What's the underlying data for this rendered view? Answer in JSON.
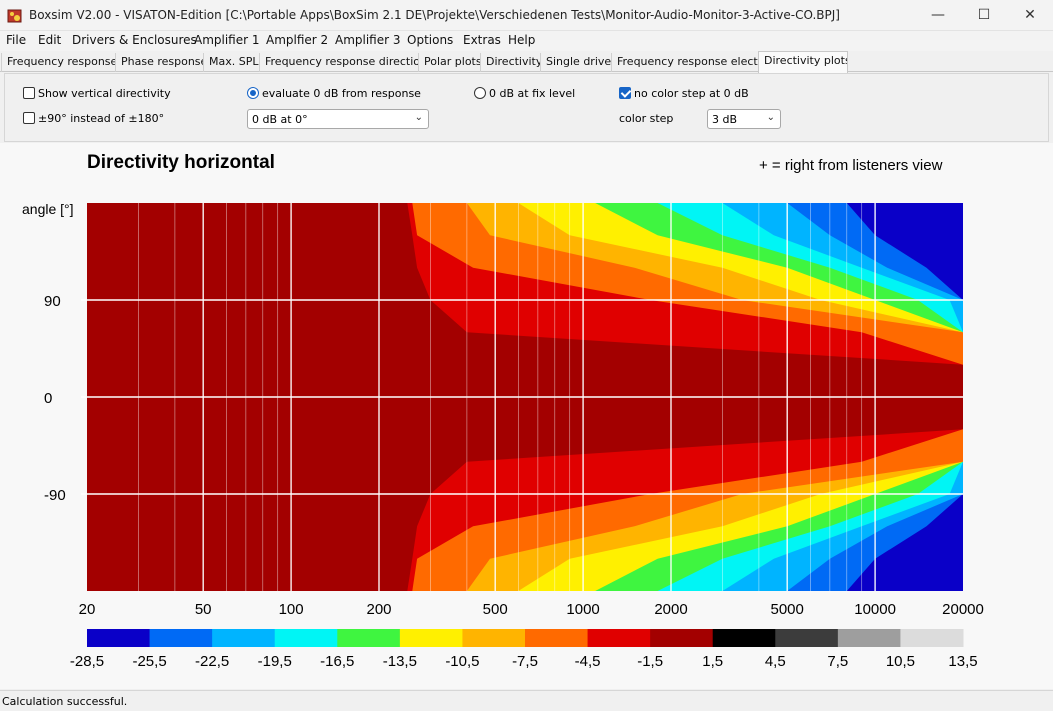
{
  "window": {
    "title": "Boxsim V2.00 - VISATON-Edition [C:\\Portable Apps\\BoxSim 2.1 DE\\Projekte\\Verschiedenen Tests\\Monitor-Audio-Monitor-3-Active-CO.BPJ]",
    "minimize_glyph": "—",
    "maximize_glyph": "☐",
    "close_glyph": "✕"
  },
  "menu": [
    "File",
    "Edit",
    "Drivers & Enclosures",
    "Amplifier 1",
    "Amplfier 2",
    "Amplifier 3",
    "Options",
    "Extras",
    "Help"
  ],
  "tabs": [
    "Frequency response.",
    "Phase response",
    "Max. SPL",
    "Frequency response directions",
    "Polar plots",
    "Directivity",
    "Single driver",
    "Frequency response electr..",
    "Directivity plots"
  ],
  "active_tab": "Directivity plots",
  "options": {
    "show_vertical_label": "Show vertical directivity",
    "show_vertical_checked": false,
    "range90_label": "±90° instead of ±180°",
    "range90_checked": false,
    "eval_label": "evaluate 0 dB from response",
    "fix_level_label": "0 dB at fix level",
    "eval_selected": "evaluate",
    "reference_combo": "0 dB at 0°",
    "no_color_step_label": "no color step at 0 dB",
    "no_color_step_checked": true,
    "color_step_label": "color step",
    "color_step_value": "3 dB"
  },
  "chart_data": {
    "type": "heatmap",
    "title": "Directivity horizontal",
    "note": "+ = right from listeners view",
    "ylabel": "angle [°]",
    "x_scale": "log",
    "xlim": [
      20,
      20000
    ],
    "ylim": [
      -180,
      180
    ],
    "x_ticks": [
      20,
      50,
      100,
      200,
      500,
      1000,
      2000,
      5000,
      10000,
      20000
    ],
    "x_tick_labels": [
      "20",
      "50",
      "100",
      "200",
      "500",
      "1000",
      "2000",
      "5000",
      "10000",
      "20000"
    ],
    "y_ticks": [
      90,
      0,
      -90
    ],
    "y_tick_labels": [
      "90",
      "0",
      "-90"
    ],
    "grid": true,
    "colorbar": {
      "labels": [
        "-28,5",
        "-25,5",
        "-22,5",
        "-19,5",
        "-16,5",
        "-13,5",
        "-10,5",
        "-7,5",
        "-4,5",
        "-1,5",
        "1,5",
        "4,5",
        "7,5",
        "10,5",
        "13,5"
      ],
      "colors": [
        "#0a00c8",
        "#006af5",
        "#00b4ff",
        "#00f5f5",
        "#3ff540",
        "#fff000",
        "#ffb400",
        "#ff6a00",
        "#e00000",
        "#a30000",
        "#000000",
        "#3c3c3c",
        "#9e9e9e",
        "#dcdcdc"
      ]
    },
    "boundaries_hz_by_abs_angle": {
      "angles": [
        0,
        30,
        60,
        90,
        120,
        150,
        180
      ],
      "level_-1.5": [
        20000,
        20000,
        400,
        300,
        270,
        260,
        250
      ],
      "level_-4.5": [
        20000,
        20000,
        9000,
        1700,
        420,
        270,
        260
      ],
      "level_-7.5": [
        20000,
        20000,
        20000,
        3500,
        1500,
        480,
        400
      ],
      "level_-10.5": [
        20000,
        20000,
        20000,
        6500,
        3000,
        900,
        600
      ],
      "level_-13.5": [
        20000,
        20000,
        20000,
        10000,
        5000,
        1800,
        1100
      ],
      "level_-16.5": [
        20000,
        20000,
        20000,
        14000,
        7000,
        3000,
        1800
      ],
      "level_-19.5": [
        20000,
        20000,
        20000,
        18000,
        9000,
        4500,
        3000
      ],
      "level_-22.5": [
        20000,
        20000,
        20000,
        20000,
        11000,
        7000,
        5000
      ],
      "level_-25.5": [
        20000,
        20000,
        20000,
        20000,
        15000,
        10000,
        8000
      ]
    }
  },
  "status": "Calculation successful."
}
